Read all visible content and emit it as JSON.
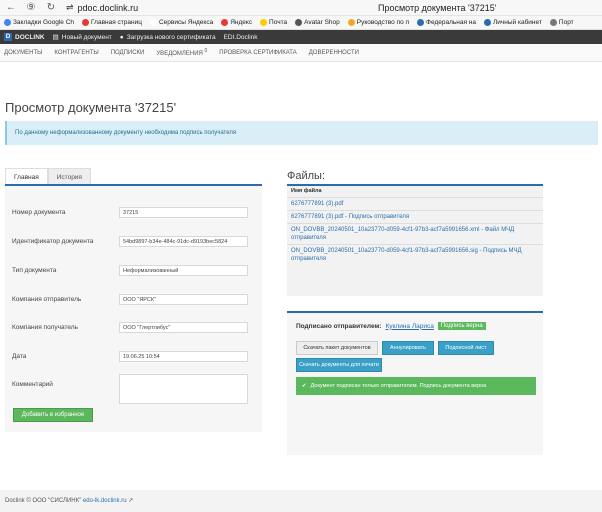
{
  "browser": {
    "url": "pdoc.doclink.ru",
    "tab_title": "Просмотр документа '37215'"
  },
  "bookmarks": [
    {
      "label": "Закладки Google Ch",
      "color": "#4285f4"
    },
    {
      "label": "Главная страниц",
      "color": "#e53935"
    },
    {
      "label": "Сервисы Яндекса",
      "color": "#ffffff"
    },
    {
      "label": "Яндекс",
      "color": "#e53935"
    },
    {
      "label": "Почта",
      "color": "#ffcc00"
    },
    {
      "label": "Avatar Shop",
      "color": "#555555"
    },
    {
      "label": "Руководство по п",
      "color": "#f5a623"
    },
    {
      "label": "Федеральная на",
      "color": "#2b6cb0"
    },
    {
      "label": "Личный кабинет",
      "color": "#2b6cb0"
    },
    {
      "label": "Порт",
      "color": "#777777"
    }
  ],
  "appbar": {
    "brand": "DOCLINK",
    "items": [
      "Новый документ",
      "Загрузка нового сертификата",
      "EDI.Doclink"
    ]
  },
  "menu": {
    "items": [
      "ДОКУМЕНТЫ",
      "КОНТРАГЕНТЫ",
      "ПОДПИСКИ",
      "УВЕДОМЛЕНИЯ",
      "ПРОВЕРКА СЕРТИФИКАТА",
      "ДОВЕРЕННОСТИ"
    ],
    "notifications_count": "0"
  },
  "page": {
    "title": "Просмотр документа '37215'",
    "info": "По данному неформализованному документу необходима подпись получателя"
  },
  "tabs": [
    "Главная",
    "История"
  ],
  "form": {
    "fields": [
      {
        "label": "Номер документа",
        "value": "37215"
      },
      {
        "label": "Идентификатор документа",
        "value": "54bd9897-b34e-484c-91dc-d9193bec5824"
      },
      {
        "label": "Тип документа",
        "value": "Неформализованный"
      },
      {
        "label": "Компания отправитель",
        "value": "ООО \"ЯРСК\""
      },
      {
        "label": "Компания получатель",
        "value": "ООО \"Глертлибус\""
      },
      {
        "label": "Дата",
        "value": "19.06.25 10:54"
      }
    ],
    "comment_label": "Комментарий",
    "comment_value": "",
    "favorite_button": "Добавить в избранное"
  },
  "files": {
    "title": "Файлы:",
    "header": "Имя файла",
    "rows": [
      "6276777891 (3).pdf",
      "6276777891 (3).pdf - Подпись отправителя",
      "ON_DOVBB_20240501_10a23770-d059-4cf1-97b3-acf7a5991656.xml - Файл МЧД отправителя",
      "ON_DOVBB_20240501_10a23770-d059-4cf1-97b3-acf7a5991656.sig - Подпись МЧД отправителя"
    ]
  },
  "sign": {
    "label": "Подписано отправителем:",
    "signer": "Куклина Лариса",
    "status": "Подпись верна",
    "buttons": {
      "download_package": "Скачать пакет документов",
      "cancel": "Аннулировать",
      "sheet": "Подписной лист",
      "print": "Скачать документы для печати"
    },
    "alert": "Документ подписан только отправителем. Подпись документа верна"
  },
  "footer": {
    "text": "Doclink © ООО \"СИСЛИНК\"",
    "link": "edo-lk.doclink.ru"
  }
}
